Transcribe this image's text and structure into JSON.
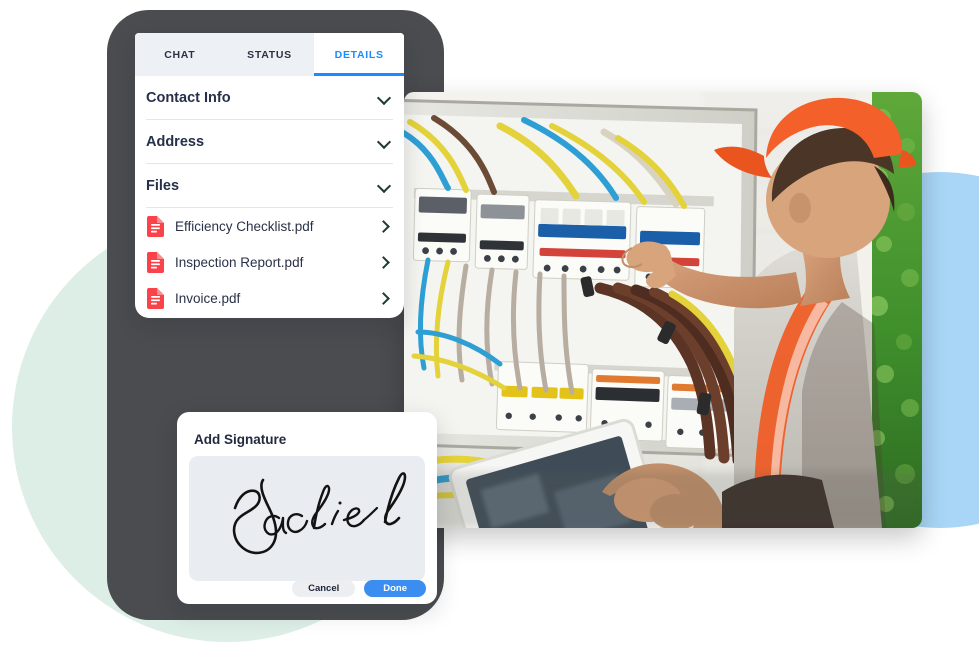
{
  "app": {
    "device_frame": "tablet-frame"
  },
  "tabs": [
    {
      "label": "CHAT",
      "active": false
    },
    {
      "label": "STATUS",
      "active": false
    },
    {
      "label": "DETAILS",
      "active": true
    }
  ],
  "sections": [
    {
      "title": "Contact Info",
      "icon": "chevron-down-icon",
      "expanded": false
    },
    {
      "title": "Address",
      "icon": "chevron-down-icon",
      "expanded": false
    },
    {
      "title": "Files",
      "icon": "chevron-down-icon",
      "expanded": true
    }
  ],
  "files": [
    {
      "name": "Efficiency Checklist.pdf",
      "icon": "pdf-file-icon",
      "chevron": "chevron-right-icon"
    },
    {
      "name": "Inspection Report.pdf",
      "icon": "pdf-file-icon",
      "chevron": "chevron-right-icon"
    },
    {
      "name": "Invoice.pdf",
      "icon": "pdf-file-icon",
      "chevron": "chevron-right-icon"
    }
  ],
  "signature_dialog": {
    "title": "Add Signature",
    "signature_text": "Jackie k",
    "cancel_label": "Cancel",
    "done_label": "Done"
  },
  "photo": {
    "alt": "Electrician in orange cap and safety vest adjusting circuit breakers in an open electrical panel while holding a tablet"
  },
  "colors": {
    "accent_blue": "#1a8cff",
    "done_button_blue": "#3b8ef0",
    "pdf_red": "#f9424a",
    "frame_gray": "#4a4c4f",
    "tab_bar_bg": "#edf0f5",
    "circle_mint": "#dceee6",
    "circle_blue": "#a9d6f7",
    "signature_canvas": "#e9ecf1"
  }
}
